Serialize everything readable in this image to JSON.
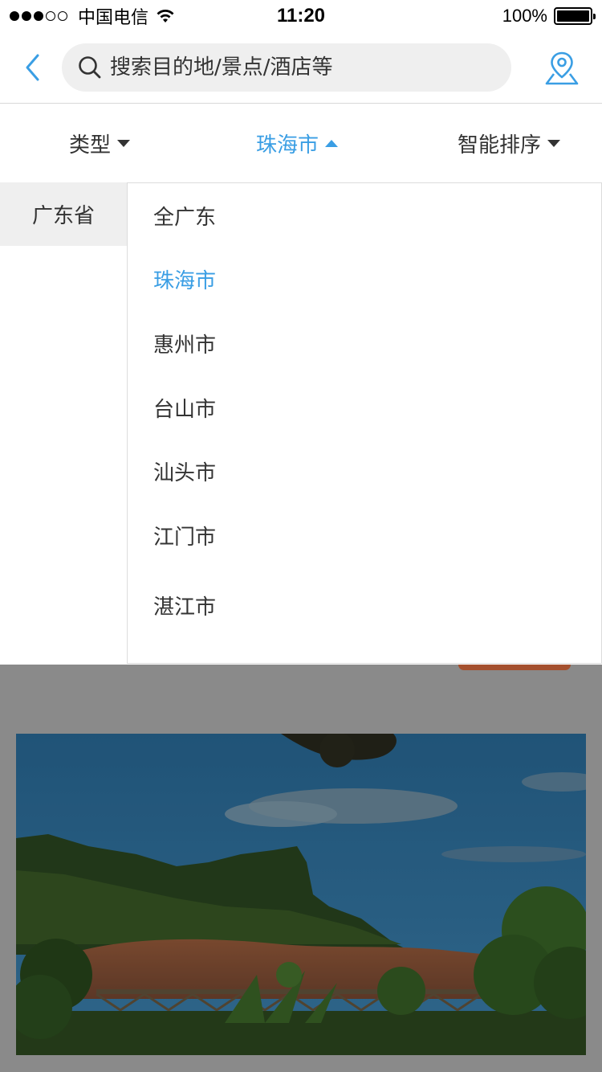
{
  "status_bar": {
    "carrier": "中国电信",
    "time": "11:20",
    "battery": "100%"
  },
  "search": {
    "placeholder": "搜索目的地/景点/酒店等"
  },
  "filters": {
    "type_label": "类型",
    "city_label": "珠海市",
    "sort_label": "智能排序"
  },
  "provinces": [
    "广东省"
  ],
  "cities": [
    "全广东",
    "珠海市",
    "惠州市",
    "台山市",
    "汕头市",
    "江门市",
    "湛江市"
  ],
  "selected_city": "珠海市",
  "colors": {
    "accent": "#3a9ee4",
    "text": "#333333"
  }
}
